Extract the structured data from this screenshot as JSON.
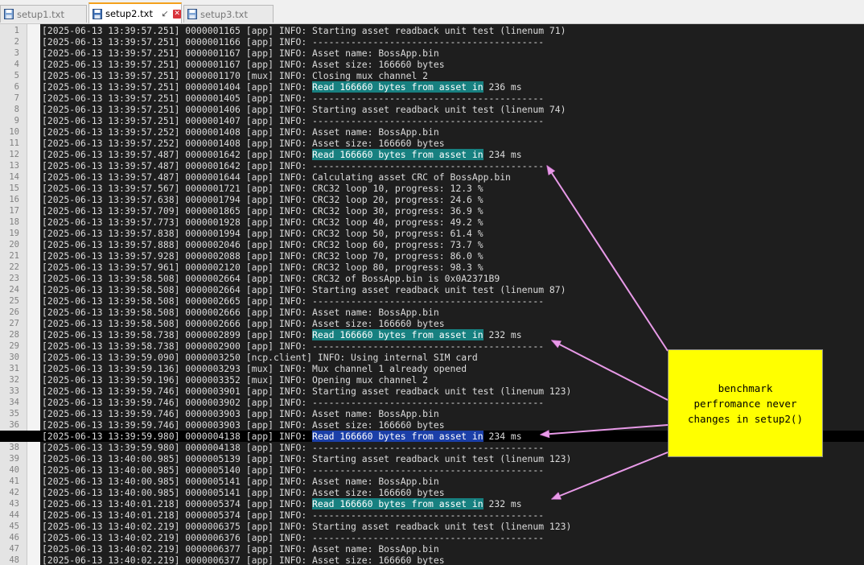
{
  "tabs": [
    {
      "label": "setup1.txt",
      "active": false,
      "pinned": false,
      "closable": false
    },
    {
      "label": "setup2.txt",
      "active": true,
      "pinned": true,
      "closable": true
    },
    {
      "label": "setup3.txt",
      "active": false,
      "pinned": false,
      "closable": false
    }
  ],
  "icons": {
    "file": "floppy-file-icon",
    "pin": "pin-icon",
    "close": "close-icon"
  },
  "colors": {
    "highlight": "#178080",
    "selection": "#1b3fa8",
    "callout": "#ffff00",
    "arrow": "#e89ae8"
  },
  "current_line": 37,
  "annotation": {
    "text": "benchmark\nperfromance never\nchanges in setup2()"
  },
  "lines": [
    {
      "pre": "[2025-06-13 13:39:57.251] 0000001165 [app] INFO: Starting asset readback unit test (linenum 71)"
    },
    {
      "pre": "[2025-06-13 13:39:57.251] 0000001166 [app] INFO: ------------------------------------------"
    },
    {
      "pre": "[2025-06-13 13:39:57.251] 0000001167 [app] INFO: Asset name: BossApp.bin"
    },
    {
      "pre": "[2025-06-13 13:39:57.251] 0000001167 [app] INFO: Asset size: 166660 bytes"
    },
    {
      "pre": "[2025-06-13 13:39:57.251] 0000001170 [mux] INFO: Closing mux channel 2"
    },
    {
      "pre": "[2025-06-13 13:39:57.251] 0000001404 [app] INFO: ",
      "hl": "Read 166660 bytes from asset in",
      "post": " 236 ms"
    },
    {
      "pre": "[2025-06-13 13:39:57.251] 0000001405 [app] INFO: ------------------------------------------"
    },
    {
      "pre": "[2025-06-13 13:39:57.251] 0000001406 [app] INFO: Starting asset readback unit test (linenum 74)"
    },
    {
      "pre": "[2025-06-13 13:39:57.251] 0000001407 [app] INFO: ------------------------------------------"
    },
    {
      "pre": "[2025-06-13 13:39:57.252] 0000001408 [app] INFO: Asset name: BossApp.bin"
    },
    {
      "pre": "[2025-06-13 13:39:57.252] 0000001408 [app] INFO: Asset size: 166660 bytes"
    },
    {
      "pre": "[2025-06-13 13:39:57.487] 0000001642 [app] INFO: ",
      "hl": "Read 166660 bytes from asset in",
      "post": " 234 ms"
    },
    {
      "pre": "[2025-06-13 13:39:57.487] 0000001642 [app] INFO: ------------------------------------------"
    },
    {
      "pre": "[2025-06-13 13:39:57.487] 0000001644 [app] INFO: Calculating asset CRC of BossApp.bin"
    },
    {
      "pre": "[2025-06-13 13:39:57.567] 0000001721 [app] INFO: CRC32 loop 10, progress: 12.3 %"
    },
    {
      "pre": "[2025-06-13 13:39:57.638] 0000001794 [app] INFO: CRC32 loop 20, progress: 24.6 %"
    },
    {
      "pre": "[2025-06-13 13:39:57.709] 0000001865 [app] INFO: CRC32 loop 30, progress: 36.9 %"
    },
    {
      "pre": "[2025-06-13 13:39:57.773] 0000001928 [app] INFO: CRC32 loop 40, progress: 49.2 %"
    },
    {
      "pre": "[2025-06-13 13:39:57.838] 0000001994 [app] INFO: CRC32 loop 50, progress: 61.4 %"
    },
    {
      "pre": "[2025-06-13 13:39:57.888] 0000002046 [app] INFO: CRC32 loop 60, progress: 73.7 %"
    },
    {
      "pre": "[2025-06-13 13:39:57.928] 0000002088 [app] INFO: CRC32 loop 70, progress: 86.0 %"
    },
    {
      "pre": "[2025-06-13 13:39:57.961] 0000002120 [app] INFO: CRC32 loop 80, progress: 98.3 %"
    },
    {
      "pre": "[2025-06-13 13:39:58.508] 0000002664 [app] INFO: CRC32 of BossApp.bin is 0x0A2371B9"
    },
    {
      "pre": "[2025-06-13 13:39:58.508] 0000002664 [app] INFO: Starting asset readback unit test (linenum 87)"
    },
    {
      "pre": "[2025-06-13 13:39:58.508] 0000002665 [app] INFO: ------------------------------------------"
    },
    {
      "pre": "[2025-06-13 13:39:58.508] 0000002666 [app] INFO: Asset name: BossApp.bin"
    },
    {
      "pre": "[2025-06-13 13:39:58.508] 0000002666 [app] INFO: Asset size: 166660 bytes"
    },
    {
      "pre": "[2025-06-13 13:39:58.738] 0000002899 [app] INFO: ",
      "hl": "Read 166660 bytes from asset in",
      "post": " 232 ms"
    },
    {
      "pre": "[2025-06-13 13:39:58.738] 0000002900 [app] INFO: ------------------------------------------"
    },
    {
      "pre": "[2025-06-13 13:39:59.090] 0000003250 [ncp.client] INFO: Using internal SIM card"
    },
    {
      "pre": "[2025-06-13 13:39:59.136] 0000003293 [mux] INFO: Mux channel 1 already opened"
    },
    {
      "pre": "[2025-06-13 13:39:59.196] 0000003352 [mux] INFO: Opening mux channel 2"
    },
    {
      "pre": "[2025-06-13 13:39:59.746] 0000003901 [app] INFO: Starting asset readback unit test (linenum 123)"
    },
    {
      "pre": "[2025-06-13 13:39:59.746] 0000003902 [app] INFO: ------------------------------------------"
    },
    {
      "pre": "[2025-06-13 13:39:59.746] 0000003903 [app] INFO: Asset name: BossApp.bin"
    },
    {
      "pre": "[2025-06-13 13:39:59.746] 0000003903 [app] INFO: Asset size: 166660 bytes"
    },
    {
      "pre": "[2025-06-13 13:39:59.980] 0000004138 [app] INFO: ",
      "hl": "Read 166660 bytes from asset in",
      "post": " 234 ms",
      "selected": true
    },
    {
      "pre": "[2025-06-13 13:39:59.980] 0000004138 [app] INFO: ------------------------------------------"
    },
    {
      "pre": "[2025-06-13 13:40:00.985] 0000005139 [app] INFO: Starting asset readback unit test (linenum 123)"
    },
    {
      "pre": "[2025-06-13 13:40:00.985] 0000005140 [app] INFO: ------------------------------------------"
    },
    {
      "pre": "[2025-06-13 13:40:00.985] 0000005141 [app] INFO: Asset name: BossApp.bin"
    },
    {
      "pre": "[2025-06-13 13:40:00.985] 0000005141 [app] INFO: Asset size: 166660 bytes"
    },
    {
      "pre": "[2025-06-13 13:40:01.218] 0000005374 [app] INFO: ",
      "hl": "Read 166660 bytes from asset in",
      "post": " 232 ms"
    },
    {
      "pre": "[2025-06-13 13:40:01.218] 0000005374 [app] INFO: ------------------------------------------"
    },
    {
      "pre": "[2025-06-13 13:40:02.219] 0000006375 [app] INFO: Starting asset readback unit test (linenum 123)"
    },
    {
      "pre": "[2025-06-13 13:40:02.219] 0000006376 [app] INFO: ------------------------------------------"
    },
    {
      "pre": "[2025-06-13 13:40:02.219] 0000006377 [app] INFO: Asset name: BossApp.bin"
    },
    {
      "pre": "[2025-06-13 13:40:02.219] 0000006377 [app] INFO: Asset size: 166660 bytes"
    }
  ]
}
